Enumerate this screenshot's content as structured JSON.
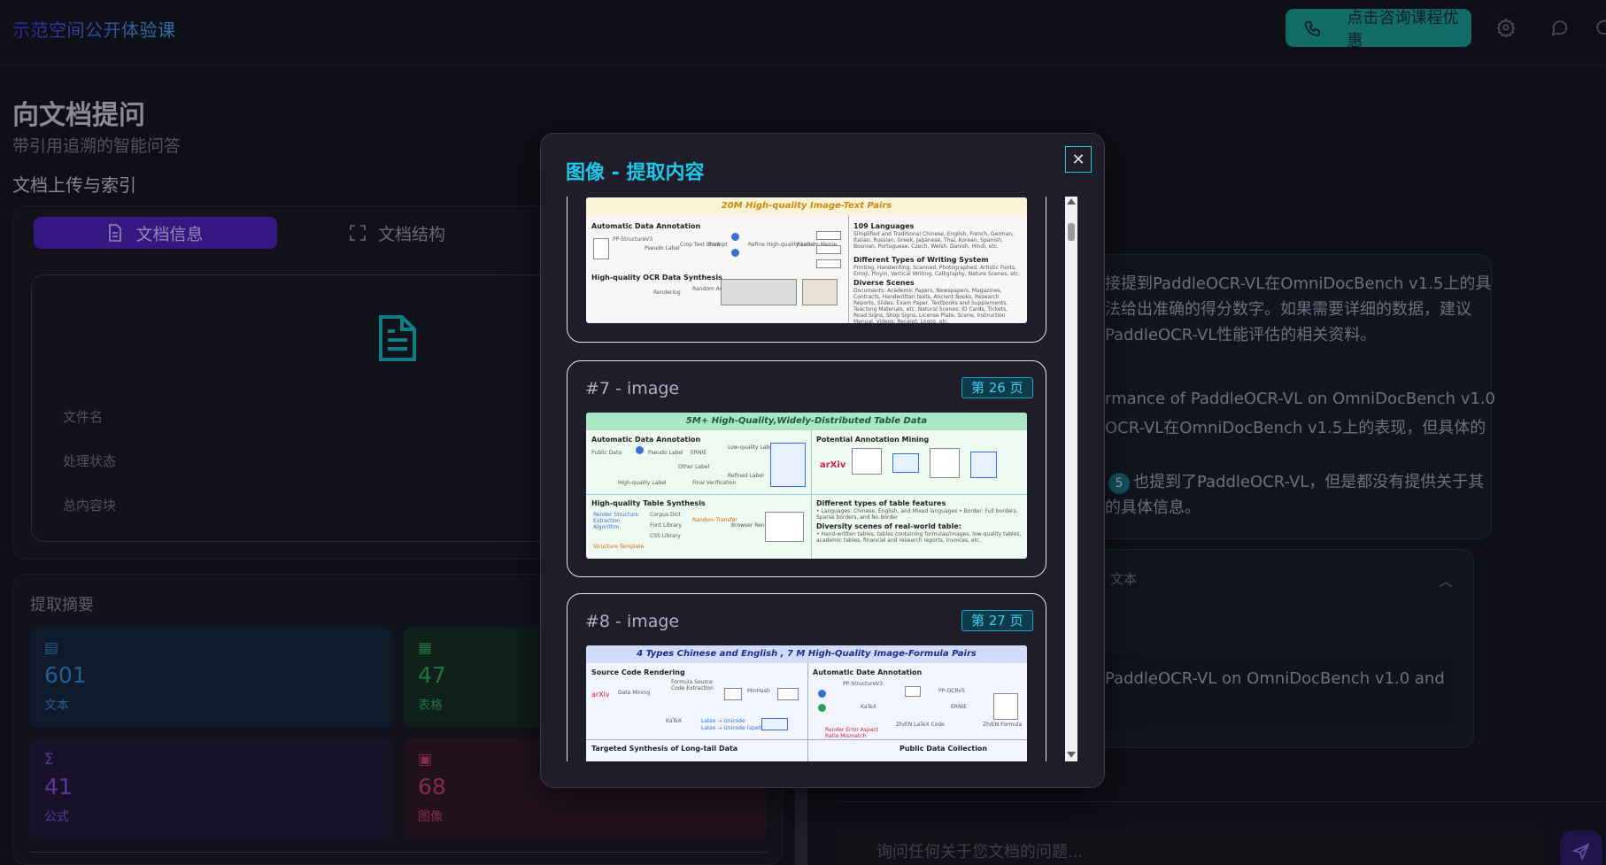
{
  "app": {
    "brand": "示范空间公开体验课",
    "consult_button": "点击咨询课程优惠"
  },
  "left": {
    "page_title": "向文档提问",
    "page_subtitle": "带引用追溯的智能问答",
    "upload_label": "文档上传与索引",
    "tabs": [
      {
        "label": "文档信息",
        "active": true
      },
      {
        "label": "文档结构",
        "active": false
      }
    ],
    "fields": [
      "文件名",
      "处理状态",
      "总内容块"
    ],
    "summary_title": "提取摘要",
    "stats": [
      {
        "value": "601",
        "label": "文本",
        "color": "#2f7ec0",
        "bg": "#15253a",
        "icon": "document-icon"
      },
      {
        "value": "47",
        "label": "表格",
        "color": "#2e9a55",
        "bg": "#142a22",
        "icon": "table-icon"
      },
      {
        "value": "41",
        "label": "公式",
        "color": "#7a4ad0",
        "bg": "#221a38",
        "icon": "sigma-icon"
      },
      {
        "value": "68",
        "label": "图像",
        "color": "#b03a68",
        "bg": "#2e1826",
        "icon": "image-icon"
      }
    ]
  },
  "chat": {
    "lines": [
      "接提到PaddleOCR-VL在OmniDocBench v1.5上的具",
      "法给出准确的得分数字。如果需要详细的数据，建议",
      "PaddleOCR-VL性能评估的相关资料。",
      "rmance of PaddleOCR-VL on OmniDocBench v1.0",
      "OCR-VL在OmniDocBench v1.5上的表现，但具体的",
      "也提到了PaddleOCR-VL，但是都没有提供关于其",
      "的具体信息。"
    ],
    "citation": "5",
    "ref_tag": "文本",
    "ref_text": "PaddleOCR-VL on OmniDocBench v1.0 and",
    "input_placeholder": "询问任何关于您文档的问题..."
  },
  "modal": {
    "title": "图像 - 提取内容",
    "items": [
      {
        "title": "",
        "page": "",
        "thumb_header": "20M High-quality Image-Text Pairs",
        "thumb_header_color": "#fbf3d6"
      },
      {
        "title": "#7 - image",
        "page": "第 26 页",
        "thumb_header": "5M+ High-Quality,Widely-Distributed Table Data",
        "thumb_header_color": "#bfe9cf"
      },
      {
        "title": "#8 - image",
        "page": "第 27 页",
        "thumb_header": "4 Types Chinese and English , 7 M High-Quality Image-Formula Pairs",
        "thumb_header_color": "#dde4fb"
      }
    ],
    "thumb1": {
      "left_a": "Automatic Data Annotation",
      "left_b": "High-quality OCR Data Synthesis",
      "right_a": "109 Languages",
      "right_b": "Different Types of Writing System",
      "right_c": "Diverse Scenes",
      "steps": [
        "PP-StructureV3",
        "Pseudo Label",
        "Crop Text block",
        "Prompt",
        "Refine",
        "High-quality Label",
        "Random Merge"
      ],
      "steps_b": [
        "Rendering",
        "Random Augmentation"
      ],
      "lang_text": "Simplified and Traditional Chinese, English, French, German, Italian, Russian, Greek, Japanese, Thai, Korean, Spanish, Bosnian, Portuguese, Czech, Welsh, Danish, Hindi, etc.",
      "write_text": "Printing, Handwriting, Scanned, Photographed, Artistic Fonts, Emoji, Pinyin, Vertical Writing, Calligraphy, Nature Scenes, etc.",
      "scene_text": "Documents: Academic Papers, Newspapers, Magazines, Contracts, Handwritten texts, Ancient Books, Research Reports, Slides, Exam Paper, Textbooks and Supplements, Teaching Materials, etc. Natural Scenes: ID Cards, Tickets, Road Signs, Shop Signs, License Plate, Scene, Instruction Manual, Videos, Receipt, Logos, etc."
    },
    "thumb2": {
      "left_a": "Automatic Data Annotation",
      "left_b": "High-quality Table Synthesis",
      "right_a": "Potential Annotation Mining",
      "right_b": "Different types of table features",
      "right_c": "Diversity scenes of real-world table:",
      "labels_a": [
        "Public Data",
        "Pseudo Label",
        "ERNIE",
        "Low-quality Label",
        "Other Label",
        "Refined Label",
        "High-quality Label",
        "Final Verification"
      ],
      "labels_b": [
        "Render Structure Extraction Algorithm",
        "Corpus Dict",
        "Font Library",
        "CSS Library",
        "Random Transfer",
        "Browser Rendering",
        "Structure Template"
      ],
      "feat_text": "• Languages: Chinese, English, and Mixed languages • Border: Full borders, Sparse borders, and No border",
      "scene_text": "• Hand-written tables, tables containing formulas/images, low-quality tables, academic tables, financial and research reports, invoices, etc."
    },
    "thumb3": {
      "left_a": "Source Code Rendering",
      "right_a": "Automatic Date Annotation",
      "left_b": "Targeted Synthesis of  Long-tail Data",
      "right_b": "Public Data Collection",
      "labels_a": [
        "arXiv",
        "Data Mining",
        "Formula Source Code Extraction",
        "MinHash",
        "KaTeX",
        "Latex → Unicode",
        "Latex → Unicode (spell)"
      ],
      "labels_b": [
        "PP-StructureV3",
        "PP-OCRv5",
        "KaTeX",
        "ERNIE",
        "Render Error Aspect Ratio Mismatch",
        "Zh/EN LaTeX Code",
        "Zh/EN Formula"
      ]
    }
  }
}
